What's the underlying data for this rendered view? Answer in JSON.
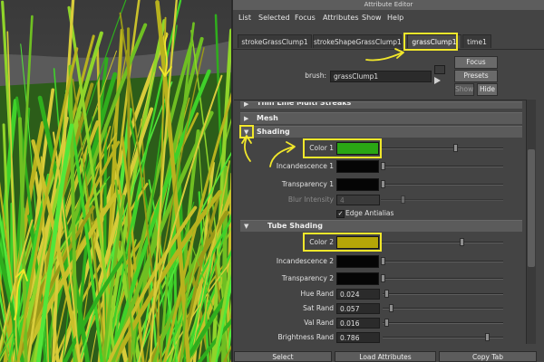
{
  "window": {
    "title": "Attribute Editor"
  },
  "menu": [
    "List",
    "Selected",
    "Focus",
    "Attributes",
    "Show",
    "Help"
  ],
  "tabs": [
    "strokeGrassClump1",
    "strokeShapeGrassClump1",
    "grassClump1",
    "time1"
  ],
  "active_tab": "grassClump1",
  "brush": {
    "label": "brush:",
    "value": "grassClump1"
  },
  "buttons": {
    "focus": "Focus",
    "presets": "Presets",
    "show": "Show",
    "hide": "Hide"
  },
  "sections": {
    "thin_line": "Thin Line Multi Streaks",
    "mesh": "Mesh",
    "shading": "Shading",
    "tube_shading": "Tube Shading"
  },
  "shading": {
    "color1": {
      "label": "Color 1",
      "color": "#2aa614",
      "slider": 0.62
    },
    "incandescence1": {
      "label": "Incandescence 1",
      "color": "#050505",
      "slider": 0.02
    },
    "transparency1": {
      "label": "Transparency 1",
      "color": "#050505",
      "slider": 0.02
    },
    "blur_intensity": {
      "label": "Blur Intensity",
      "value": "4"
    },
    "edge_antialias": {
      "label": "Edge Antialias",
      "checked": true
    }
  },
  "tube_shading": {
    "color2": {
      "label": "Color 2",
      "color": "#b5a608",
      "slider": 0.7
    },
    "incandescence2": {
      "label": "Incandescence 2",
      "color": "#050505"
    },
    "transparency2": {
      "label": "Transparency 2",
      "color": "#050505"
    },
    "hue_rand": {
      "label": "Hue Rand",
      "value": "0.024"
    },
    "sat_rand": {
      "label": "Sat Rand",
      "value": "0.057"
    },
    "val_rand": {
      "label": "Val Rand",
      "value": "0.016"
    },
    "brightness_rand": {
      "label": "Brightness Rand",
      "value": "0.786"
    }
  },
  "bottom": {
    "select": "Select",
    "load": "Load Attributes",
    "copy": "Copy Tab"
  },
  "colors": {
    "accent": "#f1e72b",
    "grass_green": "#3fd12a",
    "grass_yellow": "#b8b21e"
  }
}
